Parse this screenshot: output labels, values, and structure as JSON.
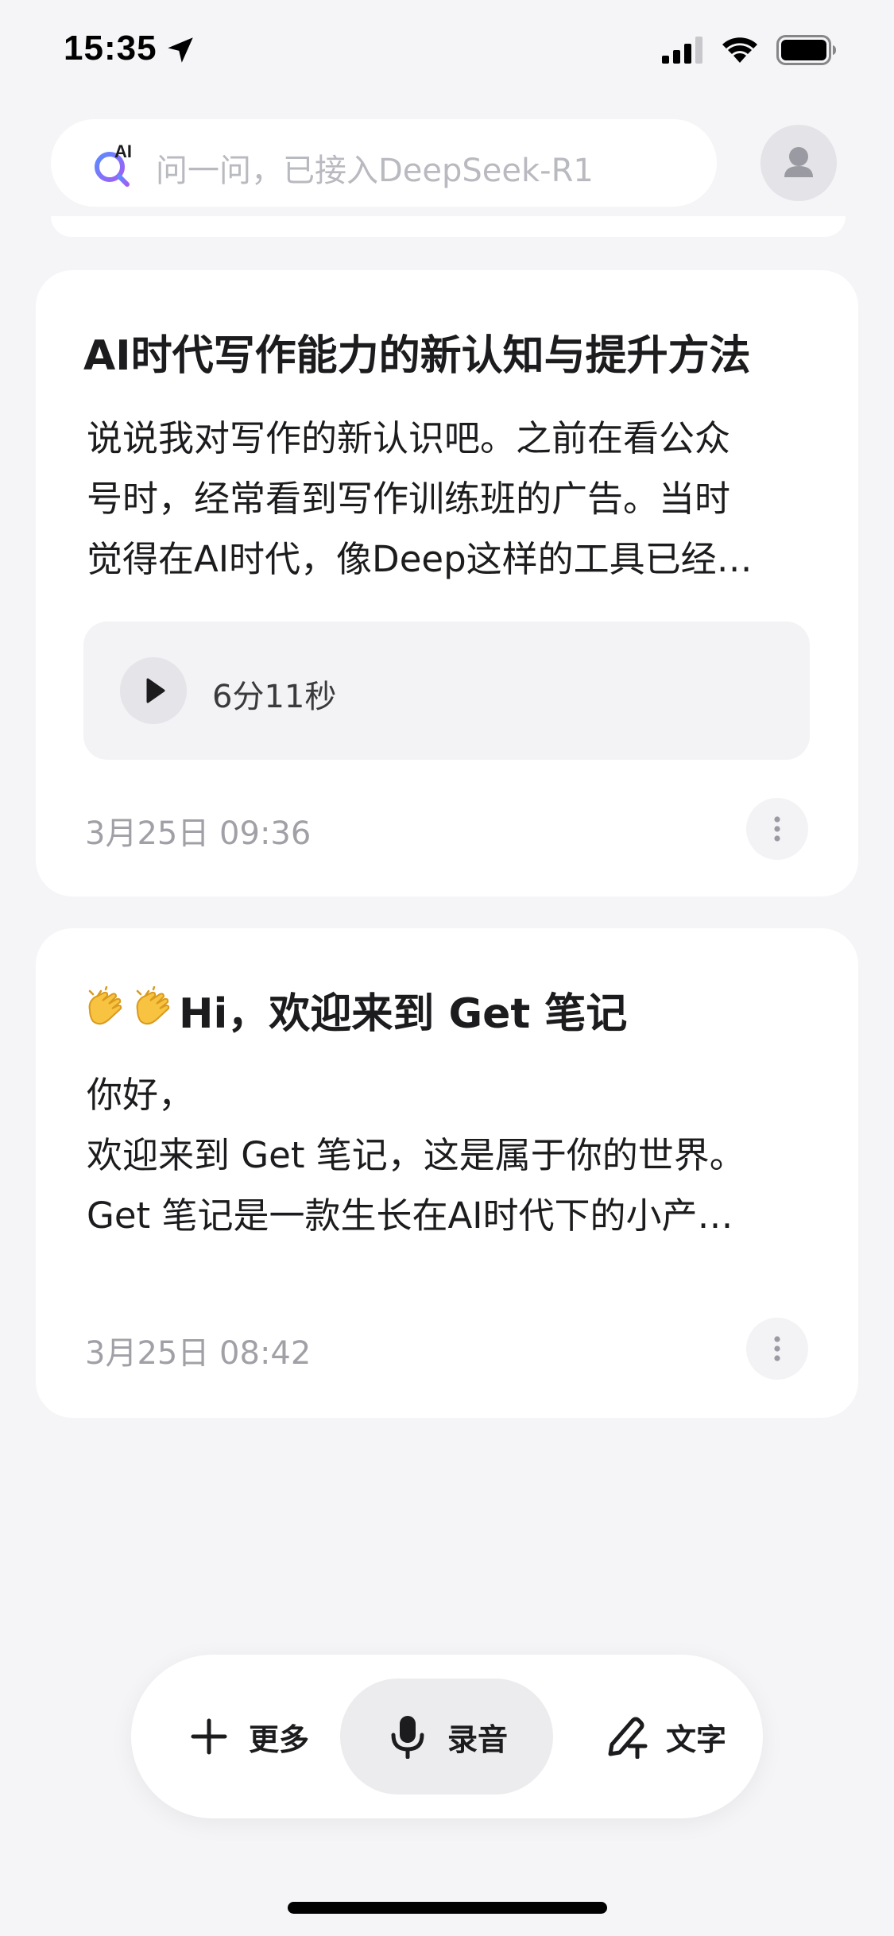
{
  "status_bar": {
    "time": "15:35",
    "icons": [
      "location-arrow-icon",
      "cellular-signal-icon",
      "wifi-icon",
      "battery-icon"
    ]
  },
  "search": {
    "icon": "ai-search-icon",
    "placeholder": "问一问，已接入DeepSeek-R1"
  },
  "avatar": {
    "icon": "user-avatar-icon"
  },
  "notes": [
    {
      "title": "AI时代写作能力的新认知与提升方法",
      "excerpt_lines": [
        "说说我对写作的新认识吧。之前在看公众",
        "号时，经常看到写作训练班的广告。当时",
        "觉得在AI时代，像Deep这样的工具已经…"
      ],
      "audio": {
        "duration": "6分11秒"
      },
      "date": "3月25日 09:36"
    },
    {
      "title": "Hi，欢迎来到 Get 笔记",
      "title_emoji": [
        "clapping-hands-emoji",
        "clapping-hands-emoji"
      ],
      "excerpt_lines": [
        "你好，",
        "欢迎来到 Get 笔记，这是属于你的世界。",
        "Get 笔记是一款生长在AI时代下的小产…"
      ],
      "date": "3月25日 08:42"
    }
  ],
  "action_bar": {
    "more_label": "更多",
    "record_label": "录音",
    "text_label": "文字"
  },
  "colors": {
    "background": "#f5f5f7",
    "card": "#ffffff",
    "accent": "#7b6cf6",
    "muted_text": "#a0a0a6"
  }
}
